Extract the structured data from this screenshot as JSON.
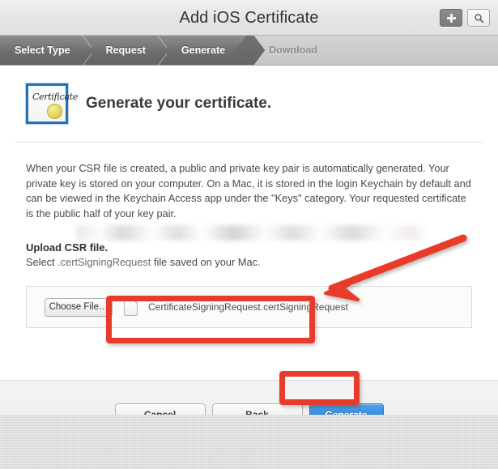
{
  "window": {
    "title": "Add iOS Certificate",
    "titlebar_buttons": [
      {
        "name": "add-button",
        "icon": "plus-icon",
        "label": "+"
      },
      {
        "name": "search-button",
        "icon": "search-icon",
        "label": ""
      }
    ]
  },
  "breadcrumb": {
    "steps": [
      {
        "label": "Select Type",
        "state": "done"
      },
      {
        "label": "Request",
        "state": "done"
      },
      {
        "label": "Generate",
        "state": "current"
      },
      {
        "label": "Download",
        "state": "todo"
      }
    ]
  },
  "main": {
    "icon_name": "certificate-icon",
    "certificate_icon_word": "Certificate",
    "heading": "Generate your certificate.",
    "paragraph": "When your CSR file is created, a public and private key pair is automatically generated. Your private key is stored on your computer. On a Mac, it is stored in the login Keychain by default and can be viewed in the Keychain Access app under the \"Keys\" category. Your requested certificate is the public half of your key pair.",
    "upload": {
      "title": "Upload CSR file.",
      "subtitle_prefix": "Select ",
      "subtitle_mono": ".certSigningRequest",
      "subtitle_suffix": " file saved on your Mac.",
      "redacted_note": ""
    },
    "file_picker": {
      "choose_label": "Choose File…",
      "file_icon": "document-icon",
      "file_name": "CertificateSigningRequest.certSigningRequest"
    }
  },
  "footer": {
    "buttons": [
      {
        "label": "Cancel",
        "style": "plain",
        "name": "cancel-button"
      },
      {
        "label": "Back",
        "style": "plain",
        "name": "back-button"
      },
      {
        "label": "Generate",
        "style": "primary",
        "name": "generate-button"
      }
    ]
  },
  "annotations": {
    "highlight_color": "#e83b2c",
    "arrow": {
      "name": "red-arrow-annotation"
    },
    "rect_file": {
      "name": "red-highlight-file-field"
    },
    "rect_generate": {
      "name": "red-highlight-generate-button"
    }
  },
  "colors": {
    "accent_blue": "#3b8fdd",
    "annotation_red": "#e83b2c",
    "crumb_active": "#6e6e6e"
  }
}
